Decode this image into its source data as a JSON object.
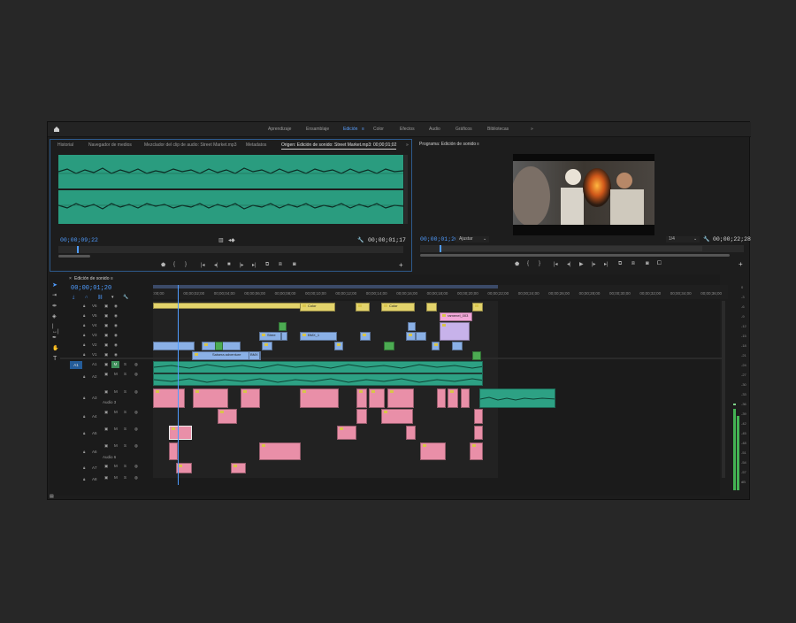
{
  "workspaces": [
    "Aprendizaje",
    "Ensamblaje",
    "Edición",
    "Color",
    "Efectos",
    "Audio",
    "Gráficos",
    "Bibliotecas"
  ],
  "workspace_active": "Edición",
  "source_panel": {
    "tabs": [
      "Historial",
      "Navegador de medios",
      "Mezclador del clip de audio: Street Market.mp3",
      "Metadatos",
      "Origen: Edición de sonido: Street Market.mp3: 00;00;01;02"
    ],
    "timecode_in": "00;00;09;22",
    "timecode_dur": "00;00;01;17"
  },
  "program_panel": {
    "title": "Programa: Edición de sonido",
    "timecode": "00;00;01;20",
    "fit": "Ajustar",
    "fraction": "1/4",
    "duration": "00;00;22;28"
  },
  "timeline": {
    "title": "Edición de sonido",
    "timecode": "00;00;01;20",
    "ruler": [
      ":00;00",
      "00;00;02;00",
      "00;00;04;00",
      "00;00;06;00",
      "00;00;08;00",
      "00;00;10;00",
      "00;00;12;00",
      "00;00;14;00",
      "00;00;16;00",
      "00;00;18;00",
      "00;00;20;00",
      "00;00;22;00",
      "00;00;24;00",
      "00;00;26;00",
      "00;00;28;00",
      "00;00;30;00",
      "00;00;32;00",
      "00;00;34;00",
      "00;00;36;00"
    ],
    "video_tracks": [
      "V6",
      "V5",
      "V4",
      "V3",
      "V2",
      "V1"
    ],
    "audio_tracks": [
      "A1",
      "A2",
      "A3",
      "A4",
      "A5",
      "A6",
      "A7",
      "A8"
    ],
    "audio_names": {
      "a3": "Audio 3",
      "a6": "Audio 6"
    },
    "clip_labels": {
      "c1": "Color",
      "c2": "Color",
      "c3": "ramenel_003",
      "c4": "Stree",
      "c5": "BMX_1",
      "c6": "BMX_2",
      "c7": "Kebab",
      "c8": "Salsera adventure",
      "c9": "BMX"
    },
    "source_labels": {
      "a1": "A1",
      "v1": "V1"
    }
  },
  "meter_labels": [
    "0",
    "-3",
    "-6",
    "-9",
    "-12",
    "-15",
    "-18",
    "-21",
    "-24",
    "-27",
    "-30",
    "-33",
    "-36",
    "-39",
    "-42",
    "-45",
    "-48",
    "-51",
    "-54",
    "-57",
    "dB"
  ],
  "colors": {
    "accent": "#4f9cff",
    "audio_clip": "#2da184",
    "audio_alt": "#e98fa8",
    "video_yellow": "#e3d36b",
    "video_blue": "#8ab0e6"
  }
}
